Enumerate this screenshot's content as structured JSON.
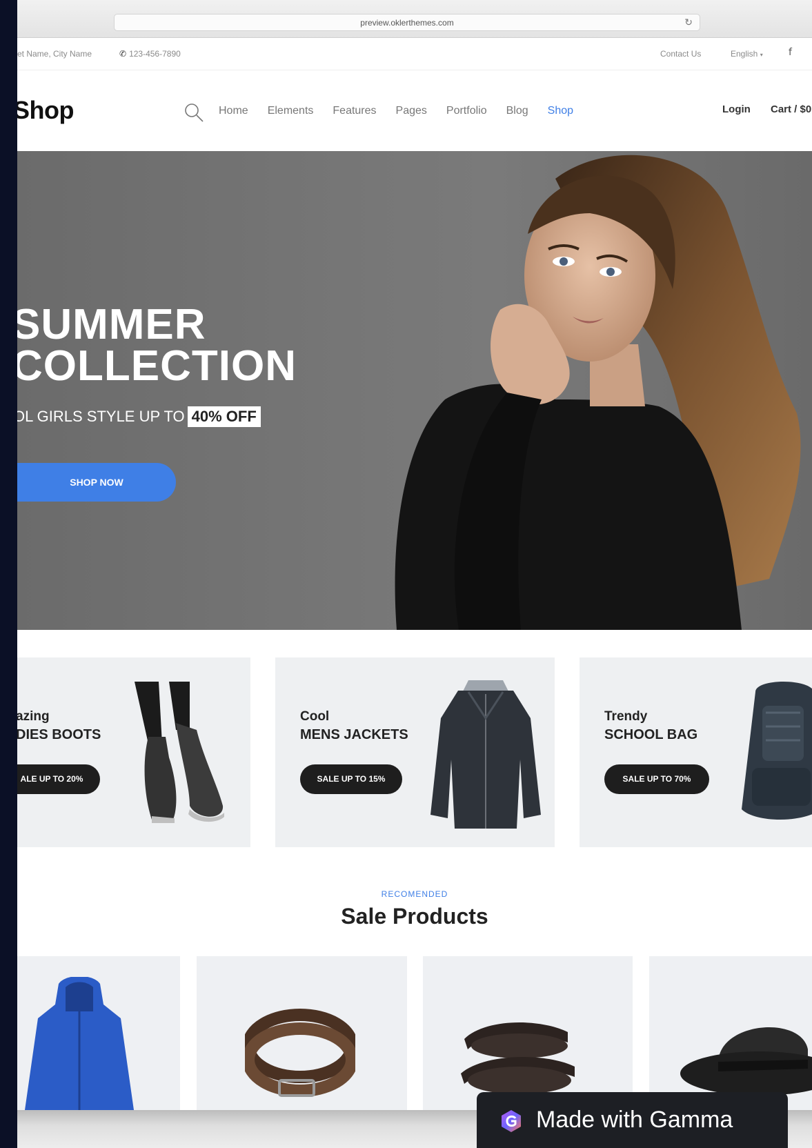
{
  "browser": {
    "url": "preview.oklerthemes.com",
    "reload_icon": "reload-icon"
  },
  "topbar": {
    "address": "et Name, City Name",
    "phone": "123-456-7890",
    "phone_icon": "phone-icon",
    "contact": "Contact Us",
    "language": "English",
    "facebook_icon": "facebook-icon"
  },
  "header": {
    "logo": "Shop",
    "search_icon": "search-icon",
    "nav": [
      {
        "label": "Home"
      },
      {
        "label": "Elements"
      },
      {
        "label": "Features"
      },
      {
        "label": "Pages"
      },
      {
        "label": "Portfolio"
      },
      {
        "label": "Blog"
      },
      {
        "label": "Shop",
        "active": true
      }
    ],
    "login": "Login",
    "cart": "Cart / $0"
  },
  "hero": {
    "line1": "SUMMER",
    "line2": "COLLECTION",
    "subtitle": "OL GIRLS STYLE UP TO",
    "discount": "40% OFF",
    "button": "SHOP NOW"
  },
  "categories": [
    {
      "small": "azing",
      "big": "DIES BOOTS",
      "sale": "ALE UP TO 20%"
    },
    {
      "small": "Cool",
      "big": "MENS JACKETS",
      "sale": "SALE UP TO 15%"
    },
    {
      "small": "Trendy",
      "big": "SCHOOL BAG",
      "sale": "SALE UP TO 70%"
    }
  ],
  "sale_products": {
    "eyebrow": "RECOMENDED",
    "title": "Sale Products"
  },
  "gamma": {
    "label": "Made with Gamma"
  },
  "colors": {
    "accent": "#3f7fe6",
    "dark": "#1e1e1e",
    "card_bg": "#eef0f2"
  }
}
